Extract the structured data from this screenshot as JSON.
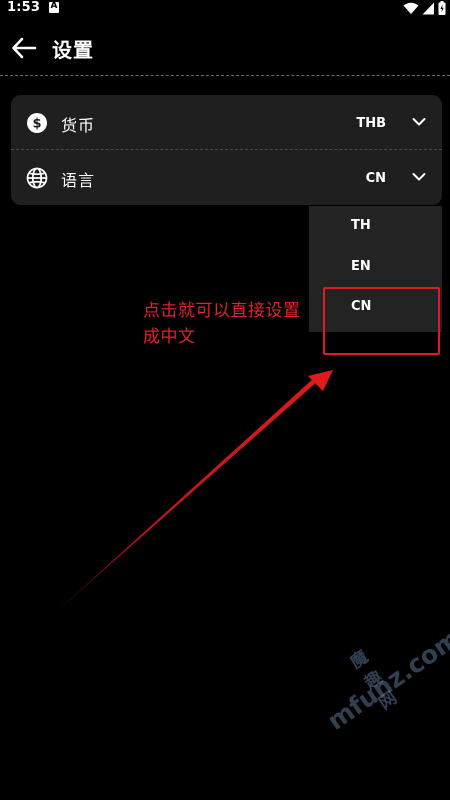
{
  "status_bar": {
    "time": "1:53",
    "notification_icon_letter": "A",
    "icons": [
      "wifi-icon",
      "signal-icon",
      "battery-icon"
    ]
  },
  "header": {
    "back_icon": "arrow-left-icon",
    "title": "设置"
  },
  "settings": {
    "rows": [
      {
        "icon": "dollar-coin-icon",
        "label": "货币",
        "value": "THB",
        "chevron": "chevron-down-icon"
      },
      {
        "icon": "globe-icon",
        "label": "语言",
        "value": "CN",
        "chevron": "chevron-down-icon"
      }
    ]
  },
  "language_dropdown": {
    "options": [
      "TH",
      "EN",
      "CN"
    ]
  },
  "annotation": {
    "text": "点击就可以直接设置成中文",
    "color": "#e0232a"
  },
  "watermark": {
    "logo_text": "魔趣网",
    "url": "mfunz.com"
  },
  "colors": {
    "background": "#000000",
    "card": "#1f1f1f",
    "dropdown": "#232323",
    "accent_red": "#e01b1b"
  }
}
